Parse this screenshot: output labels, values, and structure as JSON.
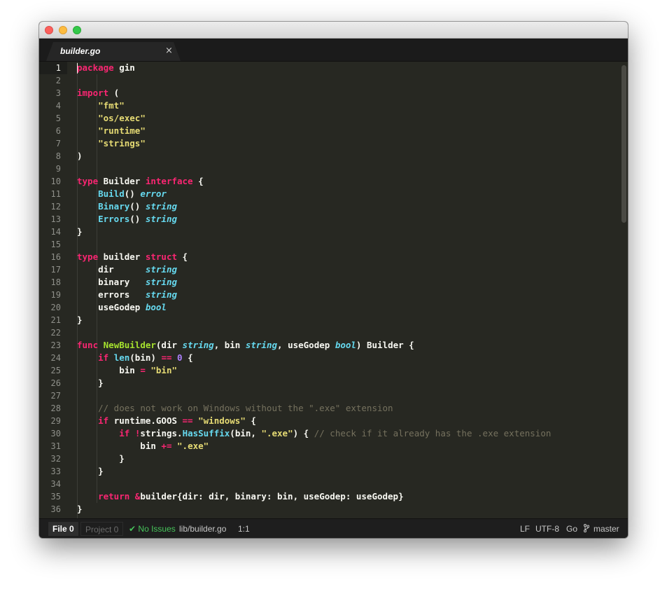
{
  "window": {
    "buttons": [
      "close",
      "minimize",
      "zoom"
    ]
  },
  "tabs": [
    {
      "title": "builder.go",
      "close_glyph": "×",
      "active": true
    }
  ],
  "editor": {
    "visible_lines": 36,
    "active_line": 1,
    "lines": [
      [
        [
          "kw",
          "package"
        ],
        [
          "plain",
          " gin"
        ]
      ],
      [],
      [
        [
          "kw",
          "import"
        ],
        [
          "plain",
          " ("
        ]
      ],
      [
        [
          "plain",
          "    "
        ],
        [
          "str",
          "\"fmt\""
        ]
      ],
      [
        [
          "plain",
          "    "
        ],
        [
          "str",
          "\"os/exec\""
        ]
      ],
      [
        [
          "plain",
          "    "
        ],
        [
          "str",
          "\"runtime\""
        ]
      ],
      [
        [
          "plain",
          "    "
        ],
        [
          "str",
          "\"strings\""
        ]
      ],
      [
        [
          "plain",
          ")"
        ]
      ],
      [],
      [
        [
          "kw",
          "type"
        ],
        [
          "plain",
          " Builder "
        ],
        [
          "kw",
          "interface"
        ],
        [
          "plain",
          " {"
        ]
      ],
      [
        [
          "plain",
          "    "
        ],
        [
          "call",
          "Build"
        ],
        [
          "plain",
          "() "
        ],
        [
          "type",
          "error"
        ]
      ],
      [
        [
          "plain",
          "    "
        ],
        [
          "call",
          "Binary"
        ],
        [
          "plain",
          "() "
        ],
        [
          "type",
          "string"
        ]
      ],
      [
        [
          "plain",
          "    "
        ],
        [
          "call",
          "Errors"
        ],
        [
          "plain",
          "() "
        ],
        [
          "type",
          "string"
        ]
      ],
      [
        [
          "plain",
          "}"
        ]
      ],
      [],
      [
        [
          "kw",
          "type"
        ],
        [
          "plain",
          " builder "
        ],
        [
          "kw",
          "struct"
        ],
        [
          "plain",
          " {"
        ]
      ],
      [
        [
          "plain",
          "    dir      "
        ],
        [
          "type",
          "string"
        ]
      ],
      [
        [
          "plain",
          "    binary   "
        ],
        [
          "type",
          "string"
        ]
      ],
      [
        [
          "plain",
          "    errors   "
        ],
        [
          "type",
          "string"
        ]
      ],
      [
        [
          "plain",
          "    useGodep "
        ],
        [
          "type",
          "bool"
        ]
      ],
      [
        [
          "plain",
          "}"
        ]
      ],
      [],
      [
        [
          "kw",
          "func"
        ],
        [
          "plain",
          " "
        ],
        [
          "fn",
          "NewBuilder"
        ],
        [
          "plain",
          "(dir "
        ],
        [
          "type",
          "string"
        ],
        [
          "plain",
          ", bin "
        ],
        [
          "type",
          "string"
        ],
        [
          "plain",
          ", useGodep "
        ],
        [
          "type",
          "bool"
        ],
        [
          "plain",
          ") Builder {"
        ]
      ],
      [
        [
          "plain",
          "    "
        ],
        [
          "kw",
          "if"
        ],
        [
          "plain",
          " "
        ],
        [
          "call",
          "len"
        ],
        [
          "plain",
          "(bin) "
        ],
        [
          "kw",
          "=="
        ],
        [
          "plain",
          " "
        ],
        [
          "num",
          "0"
        ],
        [
          "plain",
          " {"
        ]
      ],
      [
        [
          "plain",
          "        bin "
        ],
        [
          "kw",
          "="
        ],
        [
          "plain",
          " "
        ],
        [
          "str",
          "\"bin\""
        ]
      ],
      [
        [
          "plain",
          "    }"
        ]
      ],
      [],
      [
        [
          "plain",
          "    "
        ],
        [
          "comment",
          "// does not work on Windows without the \".exe\" extension"
        ]
      ],
      [
        [
          "plain",
          "    "
        ],
        [
          "kw",
          "if"
        ],
        [
          "plain",
          " runtime.GOOS "
        ],
        [
          "kw",
          "=="
        ],
        [
          "plain",
          " "
        ],
        [
          "str",
          "\"windows\""
        ],
        [
          "plain",
          " {"
        ]
      ],
      [
        [
          "plain",
          "        "
        ],
        [
          "kw",
          "if"
        ],
        [
          "plain",
          " "
        ],
        [
          "kw",
          "!"
        ],
        [
          "plain",
          "strings."
        ],
        [
          "call",
          "HasSuffix"
        ],
        [
          "plain",
          "(bin, "
        ],
        [
          "str",
          "\".exe\""
        ],
        [
          "plain",
          ") { "
        ],
        [
          "comment",
          "// check if it already has the .exe extension"
        ]
      ],
      [
        [
          "plain",
          "            bin "
        ],
        [
          "kw",
          "+="
        ],
        [
          "plain",
          " "
        ],
        [
          "str",
          "\".exe\""
        ]
      ],
      [
        [
          "plain",
          "        }"
        ]
      ],
      [
        [
          "plain",
          "    }"
        ]
      ],
      [],
      [
        [
          "plain",
          "    "
        ],
        [
          "kw",
          "return"
        ],
        [
          "plain",
          " "
        ],
        [
          "kw",
          "&"
        ],
        [
          "plain",
          "builder{dir: dir, binary: bin, useGodep: useGodep}"
        ]
      ],
      [
        [
          "plain",
          "}"
        ]
      ]
    ]
  },
  "statusbar": {
    "file_tab": "File 0",
    "project_tab": "Project 0",
    "issues": "No Issues",
    "issues_glyph": "✔",
    "file_path": "lib/builder.go",
    "cursor_position": "1:1",
    "line_ending": "LF",
    "encoding": "UTF-8",
    "grammar": "Go",
    "branch": "master"
  },
  "colors": {
    "editor_background": "#272822",
    "keyword": "#f92672",
    "string": "#e6db74",
    "function": "#a6e22e",
    "type": "#66d9ef",
    "number": "#ae81ff",
    "comment": "#75715e",
    "issues_ok": "#46c35a"
  }
}
